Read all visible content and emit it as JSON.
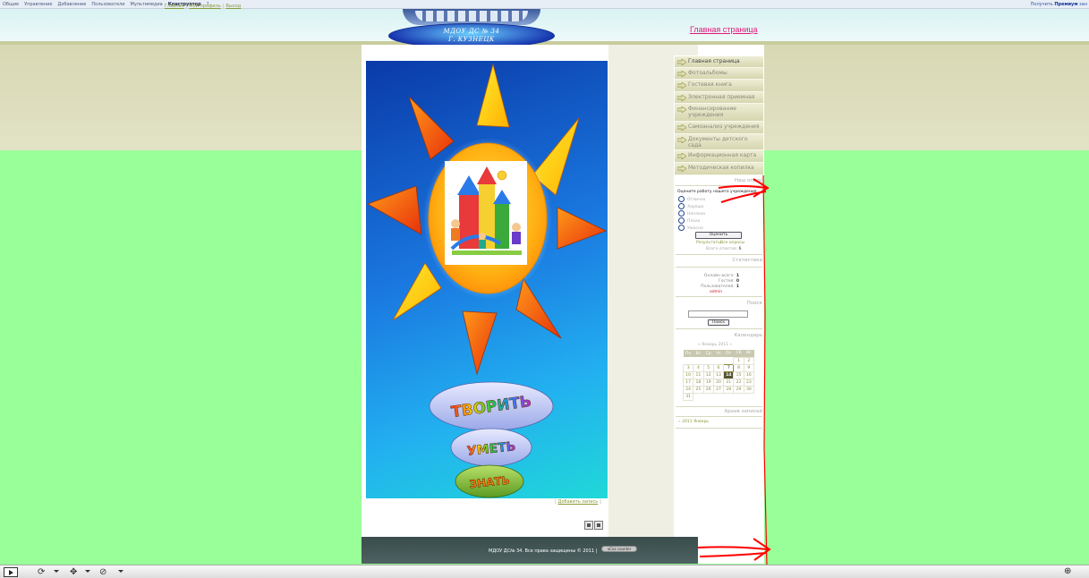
{
  "admin_bar": {
    "menu": [
      "Общие",
      "Управление",
      "Добавление",
      "Пользователи",
      "Мультимедиа",
      "Конструктор",
      "?"
    ],
    "active_menu": "Конструктор",
    "right_text": "Получить",
    "right_bold": "Премиум",
    "right_tail": "зан"
  },
  "header": {
    "logo_line1": "МДОУ ДС № 34",
    "logo_line2": "Г. КУЗНЕЦК",
    "home_link": "Главная страница"
  },
  "top_links": [
    "Главная",
    "Мой профиль",
    "Выход"
  ],
  "main_image": {
    "banner_words": [
      "ТВОРИТЬ",
      "УМЕТЬ",
      "ЗНАТЬ"
    ]
  },
  "add_entry": {
    "bracket_open": "[",
    "label": "Добавить запись",
    "bracket_close": "]"
  },
  "footer": {
    "copyright": "МДОУ ДС№ 34. Все права защищены © 2011 |",
    "counter_label": "uCoz counter"
  },
  "sidebar": {
    "menu": [
      "Главная страница",
      "Фотоальбомы",
      "Гостевая книга",
      "Электронная приемная",
      "Финансирование учреждения",
      "Самоанализ учреждения",
      "Документы детского сада",
      "Информационная карта",
      "Методическая копилка"
    ],
    "poll": {
      "title": "Наш опрос",
      "question": "Оцените работу нашего учреждения",
      "options": [
        "Отлично",
        "Хорошо",
        "Неплохо",
        "Плохо",
        "Ужасно"
      ],
      "submit": "Оценить",
      "results_link": "Результаты",
      "archive_link": "Все опросы",
      "answers_label": "Всего ответов:",
      "answers_count": "6"
    },
    "stats": {
      "title": "Статистика",
      "online_label": "Онлайн всего:",
      "online_value": "1",
      "guests_label": "Гостей:",
      "guests_value": "0",
      "users_label": "Пользователей:",
      "users_value": "1",
      "user_link": "admin"
    },
    "search": {
      "title": "Поиск",
      "button": "Поиск"
    },
    "calendar": {
      "title": "Календарь",
      "month": "« Январь 2011 »",
      "weekdays": [
        "Пн",
        "Вт",
        "Ср",
        "Чт",
        "Пт",
        "Сб",
        "Вс"
      ],
      "weeks": [
        [
          "",
          "",
          "",
          "",
          "",
          "1",
          "2"
        ],
        [
          "3",
          "4",
          "5",
          "6",
          "7",
          "8",
          "9"
        ],
        [
          "10",
          "11",
          "12",
          "13",
          "14",
          "15",
          "16"
        ],
        [
          "17",
          "18",
          "19",
          "20",
          "21",
          "22",
          "23"
        ],
        [
          "24",
          "25",
          "26",
          "27",
          "28",
          "29",
          "30"
        ],
        [
          "31",
          "",
          "",
          "",
          "",
          "",
          ""
        ]
      ],
      "today": "14",
      "marked": [
        "7"
      ]
    },
    "archive": {
      "title": "Архив записей",
      "item": "2011 Январь"
    }
  },
  "colors": {
    "body_bg": "#99ff99",
    "header_tan": "#d8d8b4",
    "home_link": "#e0187a",
    "annotation_red": "#ff0000",
    "footer_dark": "#3a4c4c"
  }
}
